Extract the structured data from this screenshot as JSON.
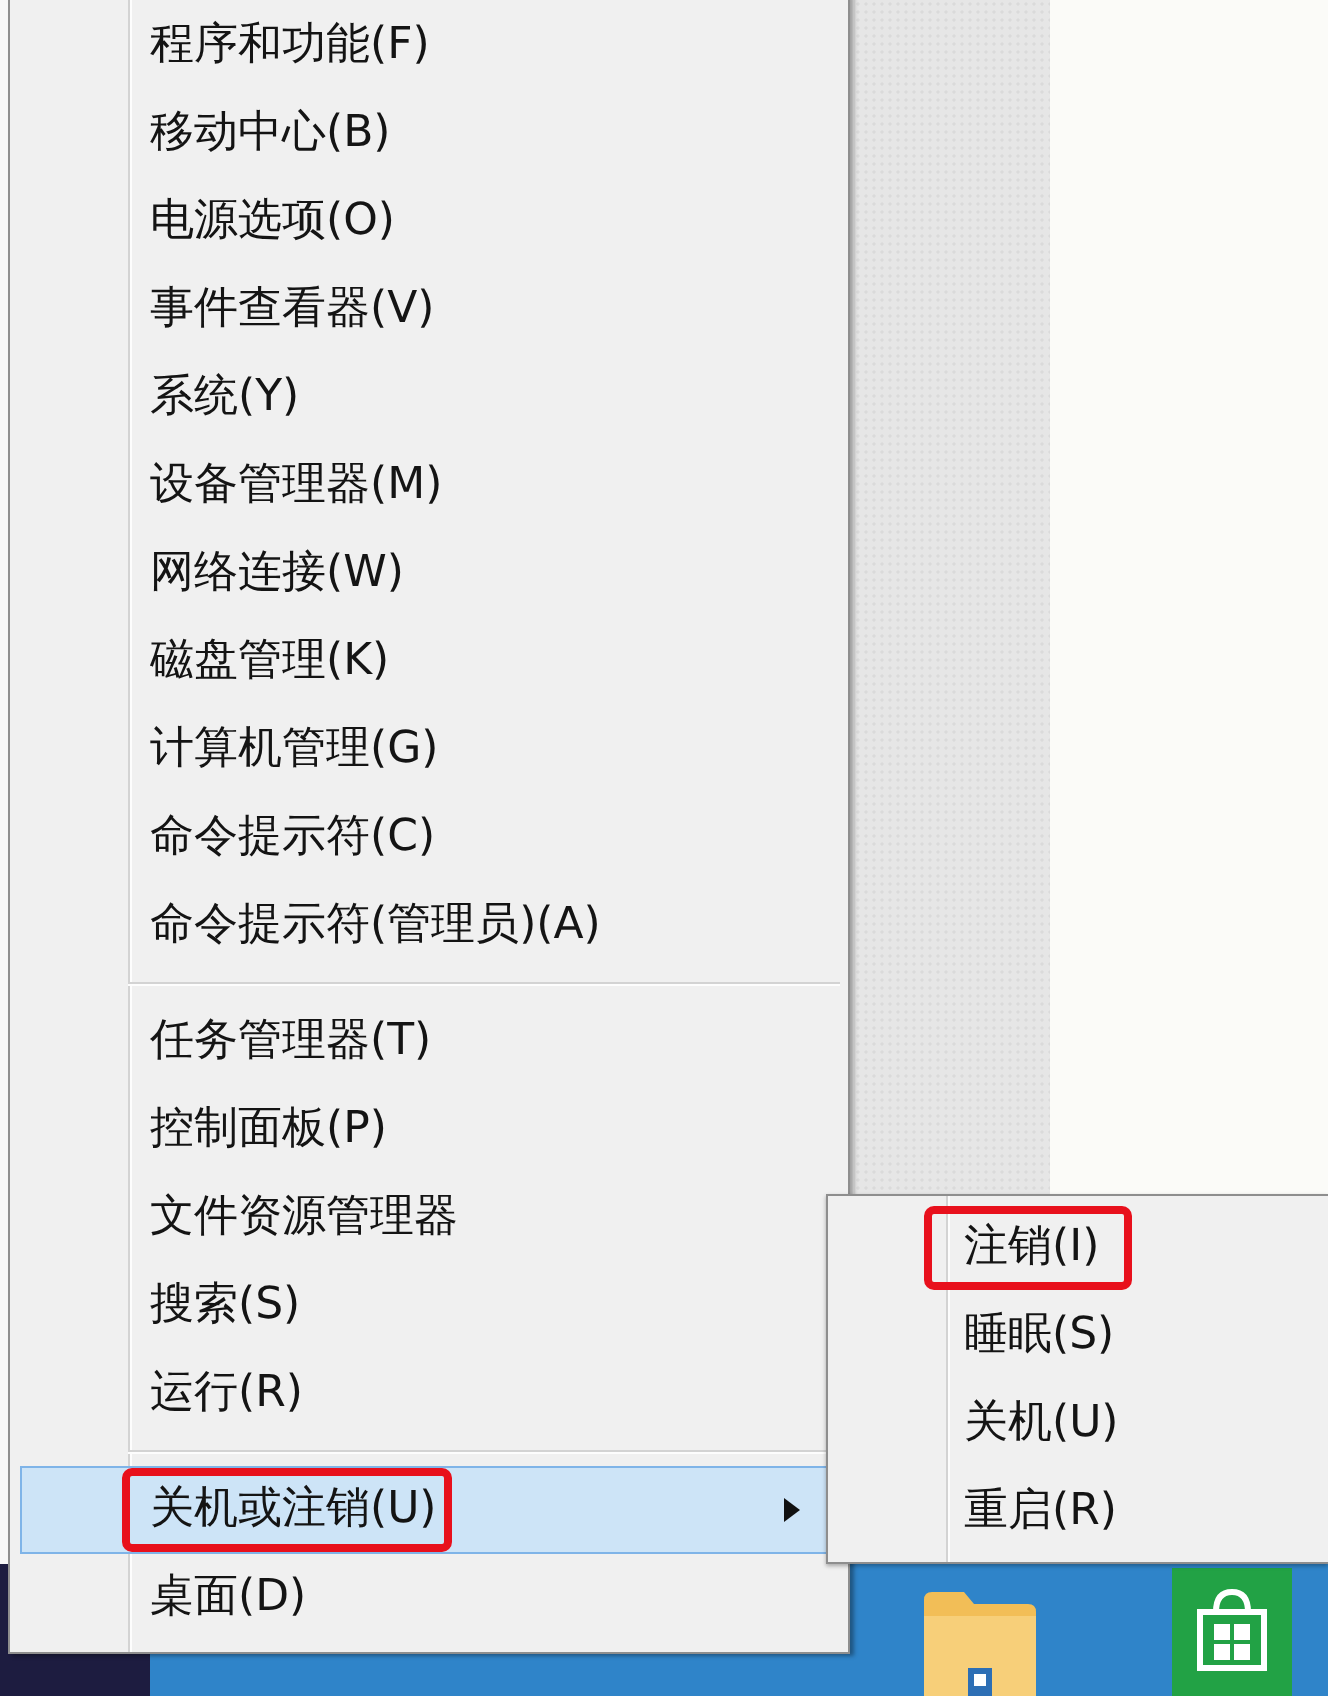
{
  "menu": {
    "groups": [
      {
        "items": [
          {
            "label": "程序和功能(F)",
            "selected": false,
            "has_submenu": false,
            "annotated": false
          },
          {
            "label": "移动中心(B)",
            "selected": false,
            "has_submenu": false,
            "annotated": false
          },
          {
            "label": "电源选项(O)",
            "selected": false,
            "has_submenu": false,
            "annotated": false
          },
          {
            "label": "事件查看器(V)",
            "selected": false,
            "has_submenu": false,
            "annotated": false
          },
          {
            "label": "系统(Y)",
            "selected": false,
            "has_submenu": false,
            "annotated": false
          },
          {
            "label": "设备管理器(M)",
            "selected": false,
            "has_submenu": false,
            "annotated": false
          },
          {
            "label": "网络连接(W)",
            "selected": false,
            "has_submenu": false,
            "annotated": false
          },
          {
            "label": "磁盘管理(K)",
            "selected": false,
            "has_submenu": false,
            "annotated": false
          },
          {
            "label": "计算机管理(G)",
            "selected": false,
            "has_submenu": false,
            "annotated": false
          },
          {
            "label": "命令提示符(C)",
            "selected": false,
            "has_submenu": false,
            "annotated": false
          },
          {
            "label": "命令提示符(管理员)(A)",
            "selected": false,
            "has_submenu": false,
            "annotated": false
          }
        ]
      },
      {
        "items": [
          {
            "label": "任务管理器(T)",
            "selected": false,
            "has_submenu": false,
            "annotated": false
          },
          {
            "label": "控制面板(P)",
            "selected": false,
            "has_submenu": false,
            "annotated": false
          },
          {
            "label": "文件资源管理器",
            "selected": false,
            "has_submenu": false,
            "annotated": false
          },
          {
            "label": "搜索(S)",
            "selected": false,
            "has_submenu": false,
            "annotated": false
          },
          {
            "label": "运行(R)",
            "selected": false,
            "has_submenu": false,
            "annotated": false
          }
        ]
      },
      {
        "items": [
          {
            "label": "关机或注销(U)",
            "selected": true,
            "has_submenu": true,
            "annotated": true
          },
          {
            "label": "桌面(D)",
            "selected": false,
            "has_submenu": false,
            "annotated": false
          }
        ]
      }
    ]
  },
  "submenu": {
    "items": [
      {
        "label": "注销(I)",
        "selected": false,
        "annotated": true
      },
      {
        "label": "睡眠(S)",
        "selected": false,
        "annotated": false
      },
      {
        "label": "关机(U)",
        "selected": false,
        "annotated": false
      },
      {
        "label": "重启(R)",
        "selected": false,
        "annotated": false
      }
    ]
  }
}
